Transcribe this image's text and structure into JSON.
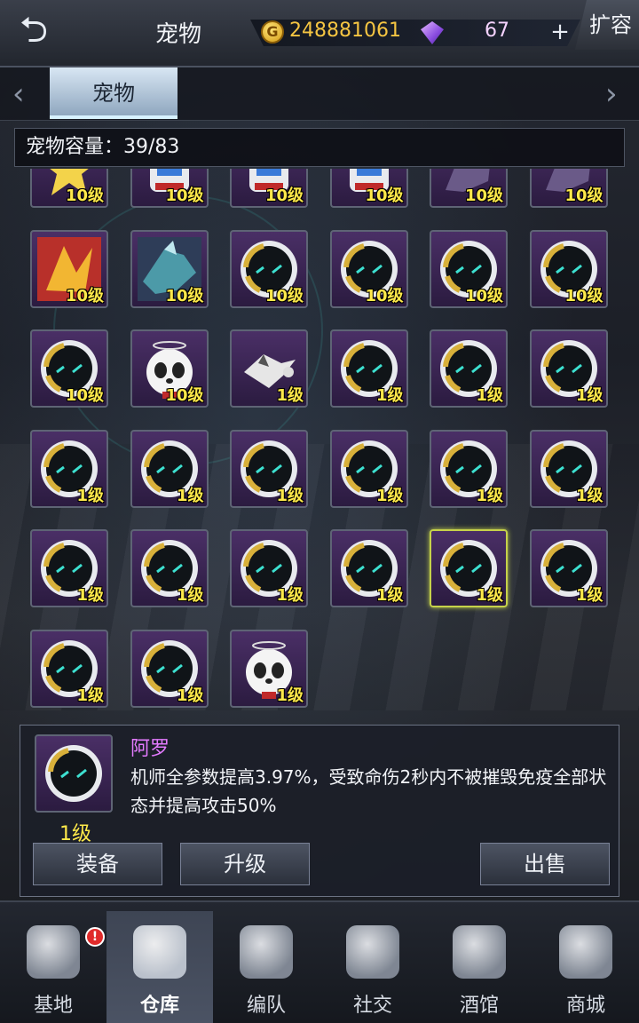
{
  "header": {
    "title": "宠物",
    "coins": "248881061",
    "gems": "67",
    "expand_label": "扩容",
    "back_icon": "back-arrow-icon",
    "plus_label": "+"
  },
  "tabs": [
    {
      "label": "宠物",
      "active": true
    }
  ],
  "capacity": {
    "text": "宠物容量：39/83"
  },
  "pets": [
    {
      "level": "10级",
      "art": "yellow-star"
    },
    {
      "level": "10级",
      "art": "robot"
    },
    {
      "level": "10级",
      "art": "robot"
    },
    {
      "level": "10级",
      "art": "robot"
    },
    {
      "level": "10级",
      "art": "mech"
    },
    {
      "level": "10级",
      "art": "mech"
    },
    {
      "level": "10级",
      "art": "fire-dragon"
    },
    {
      "level": "10级",
      "art": "ice-dragon"
    },
    {
      "level": "10级",
      "art": "helmet"
    },
    {
      "level": "10级",
      "art": "helmet"
    },
    {
      "level": "10级",
      "art": "helmet"
    },
    {
      "level": "10级",
      "art": "helmet"
    },
    {
      "level": "10级",
      "art": "helmet"
    },
    {
      "level": "10级",
      "art": "panda"
    },
    {
      "level": "1级",
      "art": "eagle"
    },
    {
      "level": "1级",
      "art": "helmet"
    },
    {
      "level": "1级",
      "art": "helmet"
    },
    {
      "level": "1级",
      "art": "helmet"
    },
    {
      "level": "1级",
      "art": "helmet"
    },
    {
      "level": "1级",
      "art": "helmet"
    },
    {
      "level": "1级",
      "art": "helmet"
    },
    {
      "level": "1级",
      "art": "helmet"
    },
    {
      "level": "1级",
      "art": "helmet"
    },
    {
      "level": "1级",
      "art": "helmet"
    },
    {
      "level": "1级",
      "art": "helmet"
    },
    {
      "level": "1级",
      "art": "helmet"
    },
    {
      "level": "1级",
      "art": "helmet"
    },
    {
      "level": "1级",
      "art": "helmet"
    },
    {
      "level": "1级",
      "art": "helmet",
      "selected": true
    },
    {
      "level": "1级",
      "art": "helmet"
    },
    {
      "level": "1级",
      "art": "helmet"
    },
    {
      "level": "1级",
      "art": "helmet"
    },
    {
      "level": "1级",
      "art": "panda"
    }
  ],
  "detail": {
    "name": "阿罗",
    "level": "1级",
    "description": "机师全参数提高3.97%，受致命伤2秒内不被摧毁免疫全部状态并提高攻击50%",
    "equip_label": "装备",
    "upgrade_label": "升级",
    "sell_label": "出售"
  },
  "bottom_nav": [
    {
      "label": "基地",
      "icon": "base-icon",
      "alert": "!"
    },
    {
      "label": "仓库",
      "icon": "warehouse-icon",
      "active": true
    },
    {
      "label": "编队",
      "icon": "formation-icon"
    },
    {
      "label": "社交",
      "icon": "handshake-icon"
    },
    {
      "label": "酒馆",
      "icon": "tavern-icon"
    },
    {
      "label": "商城",
      "icon": "shop-icon"
    }
  ]
}
